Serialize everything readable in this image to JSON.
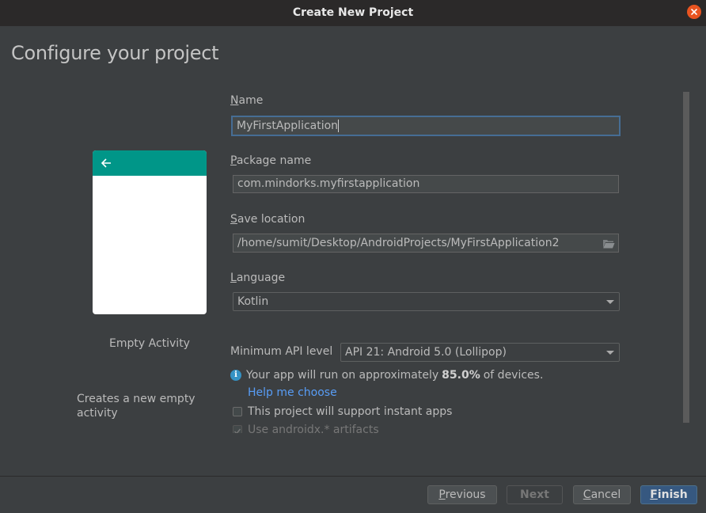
{
  "window": {
    "title": "Create New Project"
  },
  "page": {
    "title": "Configure your project"
  },
  "template": {
    "name": "Empty Activity",
    "description": "Creates a new empty activity",
    "preview_header_color": "#009688"
  },
  "form": {
    "name": {
      "label_mnemonic": "N",
      "label_rest": "ame",
      "value": "MyFirstApplication"
    },
    "package_name": {
      "label_mnemonic": "P",
      "label_rest": "ackage name",
      "value": "com.mindorks.myfirstapplication"
    },
    "save_location": {
      "label_mnemonic": "S",
      "label_rest": "ave location",
      "value": "/home/sumit/Desktop/AndroidProjects/MyFirstApplication2"
    },
    "language": {
      "label_mnemonic": "L",
      "label_rest": "anguage",
      "selected": "Kotlin"
    },
    "min_api": {
      "label": "Minimum API level",
      "selected": "API 21: Android 5.0 (Lollipop)"
    },
    "info": {
      "prefix": "Your app will run on approximately",
      "percent": "85.0%",
      "suffix": "of devices."
    },
    "help_link": "Help me choose",
    "instant_apps": {
      "label": "This project will support instant apps",
      "checked": false
    },
    "androidx": {
      "label": "Use androidx.* artifacts",
      "checked": true
    }
  },
  "buttons": {
    "previous": {
      "mnemonic": "P",
      "rest": "revious"
    },
    "next": {
      "label": "Next"
    },
    "cancel": {
      "mnemonic": "C",
      "rest": "ancel"
    },
    "finish": {
      "mnemonic": "F",
      "rest": "inish"
    }
  },
  "colors": {
    "accent": "#365880",
    "link": "#589df6",
    "close": "#e95420",
    "focus_border": "#466d94"
  }
}
